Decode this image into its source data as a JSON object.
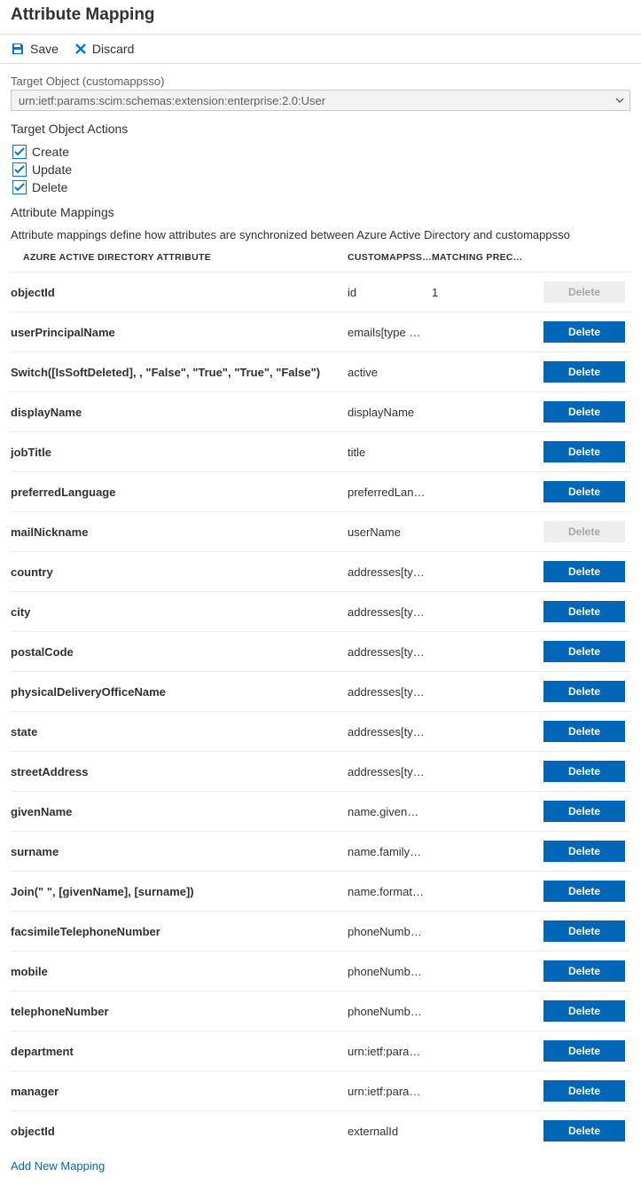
{
  "page_title": "Attribute Mapping",
  "toolbar": {
    "save": "Save",
    "discard": "Discard"
  },
  "target_object": {
    "label": "Target Object (customappsso)",
    "value": "urn:ietf:params:scim:schemas:extension:enterprise:2.0:User"
  },
  "actions": {
    "title": "Target Object Actions",
    "items": [
      "Create",
      "Update",
      "Delete"
    ]
  },
  "mappings": {
    "title": "Attribute Mappings",
    "description": "Attribute mappings define how attributes are synchronized between Azure Active Directory and customappsso",
    "headers": {
      "azure": "AZURE ACTIVE DIRECTORY ATTRIBUTE",
      "custom": "CUSTOMAPPSSO ATT…",
      "matching": "MATCHING PREC…"
    },
    "delete_label": "Delete",
    "add_new": "Add New Mapping",
    "rows": [
      {
        "azure": "objectId",
        "custom": "id",
        "matching": "1",
        "disabled": true
      },
      {
        "azure": "userPrincipalName",
        "custom": "emails[type eq \"w…",
        "matching": ""
      },
      {
        "azure": "Switch([IsSoftDeleted], , \"False\", \"True\", \"True\", \"False\")",
        "custom": "active",
        "matching": ""
      },
      {
        "azure": "displayName",
        "custom": "displayName",
        "matching": ""
      },
      {
        "azure": "jobTitle",
        "custom": "title",
        "matching": ""
      },
      {
        "azure": "preferredLanguage",
        "custom": "preferredLanguage",
        "matching": ""
      },
      {
        "azure": "mailNickname",
        "custom": "userName",
        "matching": "",
        "disabled": true
      },
      {
        "azure": "country",
        "custom": "addresses[type e…",
        "matching": ""
      },
      {
        "azure": "city",
        "custom": "addresses[type e…",
        "matching": ""
      },
      {
        "azure": "postalCode",
        "custom": "addresses[type e…",
        "matching": ""
      },
      {
        "azure": "physicalDeliveryOfficeName",
        "custom": "addresses[type e…",
        "matching": ""
      },
      {
        "azure": "state",
        "custom": "addresses[type e…",
        "matching": ""
      },
      {
        "azure": "streetAddress",
        "custom": "addresses[type e…",
        "matching": ""
      },
      {
        "azure": "givenName",
        "custom": "name.givenName",
        "matching": ""
      },
      {
        "azure": "surname",
        "custom": "name.familyName",
        "matching": ""
      },
      {
        "azure": "Join(\" \", [givenName], [surname])",
        "custom": "name.formatted",
        "matching": ""
      },
      {
        "azure": "facsimileTelephoneNumber",
        "custom": "phoneNumbers[t…",
        "matching": ""
      },
      {
        "azure": "mobile",
        "custom": "phoneNumbers[t…",
        "matching": ""
      },
      {
        "azure": "telephoneNumber",
        "custom": "phoneNumbers[t…",
        "matching": ""
      },
      {
        "azure": "department",
        "custom": "urn:ietf:params:sci…",
        "matching": ""
      },
      {
        "azure": "manager",
        "custom": "urn:ietf:params:sci…",
        "matching": ""
      },
      {
        "azure": "objectId",
        "custom": "externalId",
        "matching": ""
      }
    ]
  }
}
